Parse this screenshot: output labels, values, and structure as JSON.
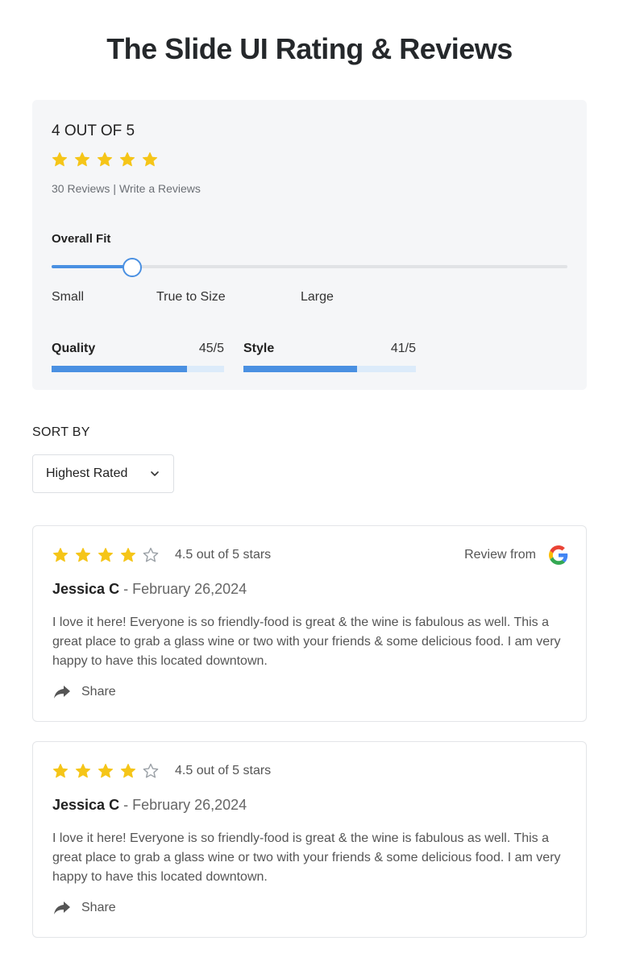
{
  "page": {
    "title": "The Slide UI Rating & Reviews"
  },
  "summary": {
    "score_label": "4 OUT OF 5",
    "rating": 5,
    "max_rating": 5,
    "review_count": "30 Reviews",
    "separator": "|",
    "write_link": "Write a Reviews",
    "fit": {
      "label": "Overall Fit",
      "value_fraction": 0.156,
      "ticks": [
        "Small",
        "True to Size",
        "Large"
      ]
    },
    "bars": [
      {
        "name": "Quality",
        "value_text": "45/5",
        "fill_fraction": 0.785
      },
      {
        "name": "Style",
        "value_text": "41/5",
        "fill_fraction": 0.66
      }
    ]
  },
  "sort": {
    "label": "SORT BY",
    "selected": "Highest Rated"
  },
  "reviews": [
    {
      "stars": 4,
      "max_stars": 5,
      "stars_text": "4.5 out of 5 stars",
      "source_label": "Review from",
      "source_icon": "google-icon",
      "name": "Jessica C",
      "date_text": " - February 26,2024",
      "body": "I love it here! Everyone is so friendly-food is great & the wine is fabulous as well. This a great place to grab a glass wine or two with your friends & some delicious food. I am very happy to have this located downtown.",
      "share_label": "Share"
    },
    {
      "stars": 4,
      "max_stars": 5,
      "stars_text": "4.5 out of 5 stars",
      "source_label": "",
      "name": "Jessica C",
      "date_text": " - February 26,2024",
      "body": "I love it here! Everyone is so friendly-food is great & the wine is fabulous as well. This a great place to grab a glass wine or two with your friends & some delicious food. I am very happy to have this located downtown.",
      "share_label": "Share"
    }
  ],
  "colors": {
    "accent": "#4a90e2",
    "star": "#f5c518",
    "panel": "#f5f6f8"
  }
}
